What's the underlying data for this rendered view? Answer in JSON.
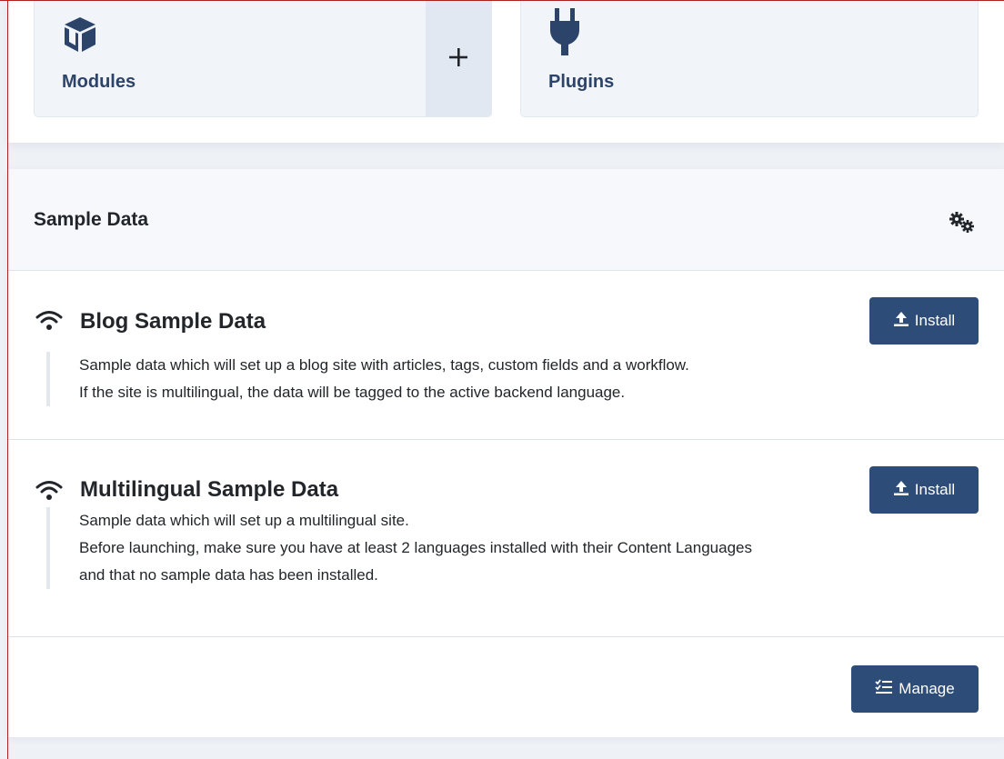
{
  "quick_icons": {
    "modules": {
      "label": "Modules",
      "icon": "cube-icon",
      "add_icon": "plus-icon"
    },
    "plugins": {
      "label": "Plugins",
      "icon": "plug-icon"
    }
  },
  "sample_data": {
    "title": "Sample Data",
    "options_icon": "gears-icon",
    "items": [
      {
        "icon": "wifi-icon",
        "title": "Blog Sample Data",
        "install_label": "Install",
        "description": [
          "Sample data which will set up a blog site with articles, tags, custom fields and a workflow.",
          "If the site is multilingual, the data will be tagged to the active backend language."
        ]
      },
      {
        "icon": "wifi-icon",
        "title": "Multilingual Sample Data",
        "install_label": "Install",
        "description": [
          "Sample data which will set up a multilingual site.",
          "Before launching, make sure you have at least 2 languages installed with their Content Languages",
          "and that no sample data has been installed."
        ]
      }
    ],
    "manage_label": "Manage"
  },
  "colors": {
    "primary_button": "#2d4d78",
    "quick_icon_label": "#2c4469",
    "frame_border": "#b22222"
  }
}
